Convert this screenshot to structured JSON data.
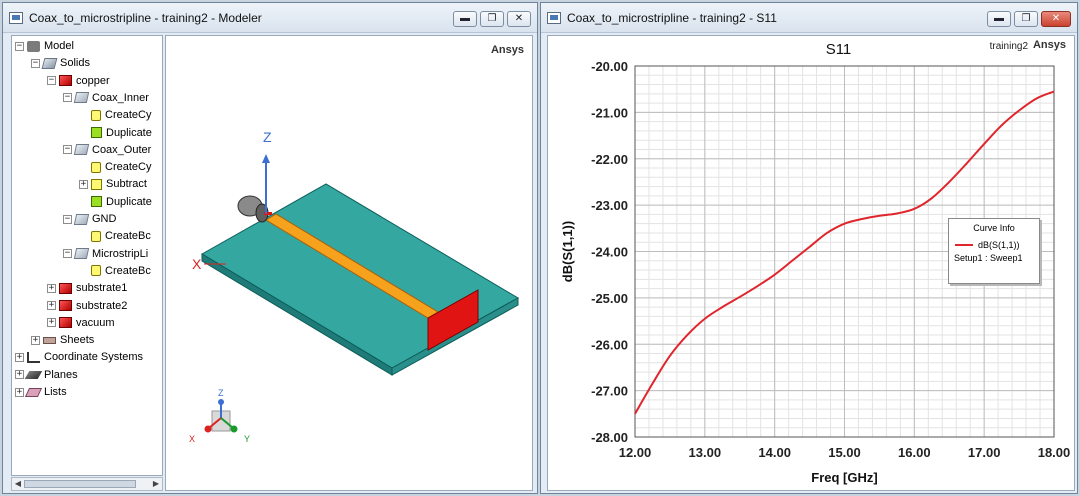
{
  "modeler_window": {
    "title": "Coax_to_microstripline - training2 - Modeler",
    "brand": "Ansys",
    "tree": [
      {
        "label": "Model",
        "icon": "model-icon",
        "expander": "−"
      },
      {
        "label": "Solids",
        "icon": "solids-icon",
        "expander": "−"
      },
      {
        "label": "copper",
        "icon": "material-icon",
        "expander": "−"
      },
      {
        "label": "Coax_Inner",
        "icon": "object-icon",
        "expander": "−"
      },
      {
        "label": "CreateCy",
        "icon": "create-cylinder-icon",
        "expander": ""
      },
      {
        "label": "Duplicate",
        "icon": "duplicate-icon",
        "expander": ""
      },
      {
        "label": "Coax_Outer",
        "icon": "object-icon",
        "expander": "−"
      },
      {
        "label": "CreateCy",
        "icon": "create-cylinder-icon",
        "expander": ""
      },
      {
        "label": "Subtract",
        "icon": "subtract-icon",
        "expander": "+"
      },
      {
        "label": "Duplicate",
        "icon": "duplicate-icon",
        "expander": ""
      },
      {
        "label": "GND",
        "icon": "object-icon",
        "expander": "−"
      },
      {
        "label": "CreateBc",
        "icon": "create-box-icon",
        "expander": ""
      },
      {
        "label": "MicrostripLi",
        "icon": "object-icon",
        "expander": "−"
      },
      {
        "label": "CreateBc",
        "icon": "create-box-icon",
        "expander": ""
      },
      {
        "label": "substrate1",
        "icon": "material-icon",
        "expander": "+"
      },
      {
        "label": "substrate2",
        "icon": "material-icon",
        "expander": "+"
      },
      {
        "label": "vacuum",
        "icon": "material-icon",
        "expander": "+"
      },
      {
        "label": "Sheets",
        "icon": "sheets-icon",
        "expander": "+"
      },
      {
        "label": "Coordinate Systems",
        "icon": "coordinate-icon",
        "expander": "+"
      },
      {
        "label": "Planes",
        "icon": "planes-icon",
        "expander": "+"
      },
      {
        "label": "Lists",
        "icon": "lists-icon",
        "expander": "+"
      }
    ],
    "axis_labels": {
      "z": "Z",
      "x": "X"
    },
    "triad_labels": {
      "z": "Z",
      "x": "X",
      "y": "Y"
    }
  },
  "plot_window": {
    "title": "Coax_to_microstripline - training2 - S11",
    "brand": "Ansys",
    "design_name": "training2"
  },
  "window_controls": {
    "minimize": "▬",
    "restore": "❐",
    "close": "✕"
  },
  "chart_data": {
    "type": "line",
    "title": "S11",
    "xlabel": "Freq [GHz]",
    "ylabel": "dB(S(1,1))",
    "xlim": [
      12.0,
      18.0
    ],
    "ylim": [
      -28.0,
      -20.0
    ],
    "x_ticks": [
      "12.00",
      "13.00",
      "14.00",
      "15.00",
      "16.00",
      "17.00",
      "18.00"
    ],
    "y_ticks": [
      "-20.00",
      "-21.00",
      "-22.00",
      "-23.00",
      "-24.00",
      "-25.00",
      "-26.00",
      "-27.00",
      "-28.00"
    ],
    "grid": true,
    "legend": {
      "title": "Curve Info",
      "position": "right",
      "entries": [
        "dB(S(1,1))",
        "Setup1 : Sweep1"
      ]
    },
    "series": [
      {
        "name": "dB(S(1,1))",
        "color": "#e0252c",
        "x": [
          12.0,
          12.25,
          12.5,
          12.75,
          13.0,
          13.25,
          13.5,
          13.75,
          14.0,
          14.25,
          14.5,
          14.75,
          15.0,
          15.25,
          15.5,
          15.75,
          16.0,
          16.25,
          16.5,
          16.75,
          17.0,
          17.25,
          17.5,
          17.75,
          18.0
        ],
        "y": [
          -27.5,
          -26.85,
          -26.25,
          -25.8,
          -25.45,
          -25.2,
          -24.98,
          -24.75,
          -24.5,
          -24.2,
          -23.9,
          -23.6,
          -23.4,
          -23.3,
          -23.23,
          -23.18,
          -23.08,
          -22.85,
          -22.5,
          -22.1,
          -21.68,
          -21.28,
          -20.96,
          -20.7,
          -20.55
        ]
      }
    ]
  }
}
